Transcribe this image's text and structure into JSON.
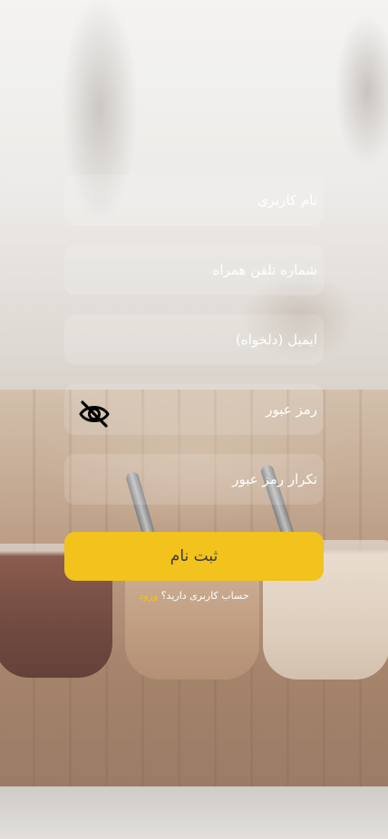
{
  "form": {
    "username_placeholder": "نام کاربری",
    "phone_placeholder": "شماره تلفن همراه",
    "email_placeholder": "ایمیل (دلخواه)",
    "password_placeholder": "رمز عبور",
    "password_confirm_placeholder": "تکرار رمز عبور",
    "password_visibility_icon": "eye-off-icon",
    "submit_label": "ثبت نام"
  },
  "footer": {
    "question": "حساب کاربری دارید؟",
    "login_label": "ورود"
  },
  "colors": {
    "accent": "#f2c21d",
    "field_text": "#ffffff"
  }
}
